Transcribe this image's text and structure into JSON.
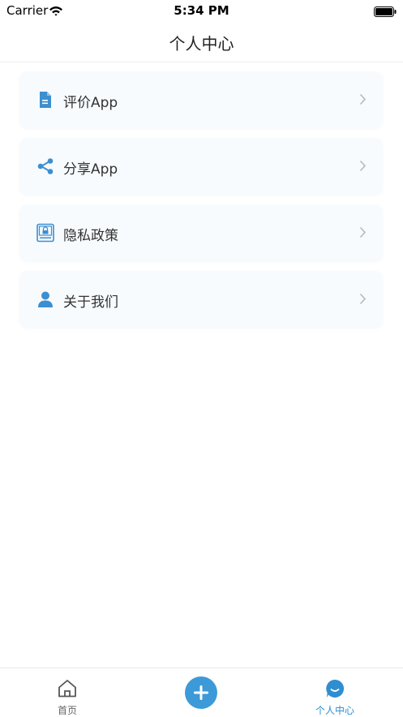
{
  "status_bar": {
    "carrier": "Carrier",
    "time": "5:34 PM"
  },
  "header": {
    "title": "个人中心"
  },
  "menu": {
    "items": [
      {
        "label": "评价App",
        "icon": "document-icon"
      },
      {
        "label": "分享App",
        "icon": "share-icon"
      },
      {
        "label": "隐私政策",
        "icon": "privacy-lock-icon"
      },
      {
        "label": "关于我们",
        "icon": "person-icon"
      }
    ]
  },
  "tab_bar": {
    "home_label": "首页",
    "add_icon": "plus-icon",
    "profile_label": "个人中心"
  },
  "colors": {
    "accent": "#3d9ad8",
    "active_tab": "#2f8ed0",
    "card_background": "#f7fbfe",
    "chevron": "#b8b8b8"
  }
}
